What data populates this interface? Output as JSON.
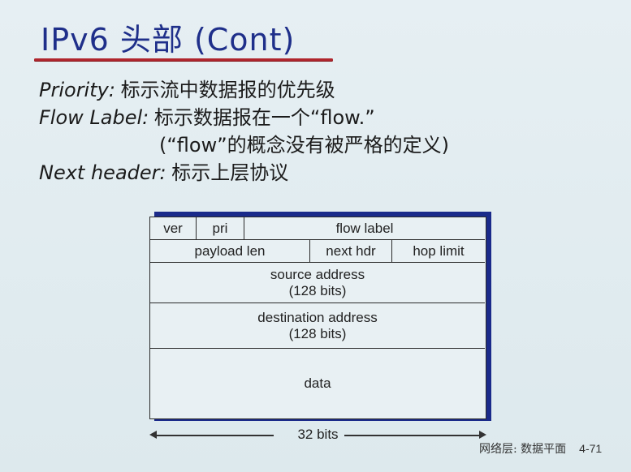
{
  "title": "IPv6 头部 (Cont)",
  "bullets": [
    {
      "term": "Priority:",
      "desc": "标示流中数据报的优先级"
    },
    {
      "term": "Flow Label:",
      "desc": "标示数据报在一个“flow.”"
    },
    {
      "term": "",
      "desc": "(“flow”的概念没有被严格的定义)"
    },
    {
      "term": "Next header:",
      "desc": "标示上层协议"
    }
  ],
  "diagram": {
    "row1": {
      "ver": "ver",
      "pri": "pri",
      "flow_label": "flow label"
    },
    "row2": {
      "payload_len": "payload len",
      "next_hdr": "next hdr",
      "hop_limit": "hop limit"
    },
    "source": {
      "line1": "source address",
      "line2": "(128 bits)"
    },
    "destination": {
      "line1": "destination address",
      "line2": "(128 bits)"
    },
    "data": "data",
    "width_label": "32 bits"
  },
  "footer": {
    "chapter": "网络层: 数据平面",
    "page": "4-71"
  },
  "colors": {
    "title": "#1f2f8a",
    "underline": "#b0252d",
    "diagram_shadow": "#1a2a8a"
  }
}
